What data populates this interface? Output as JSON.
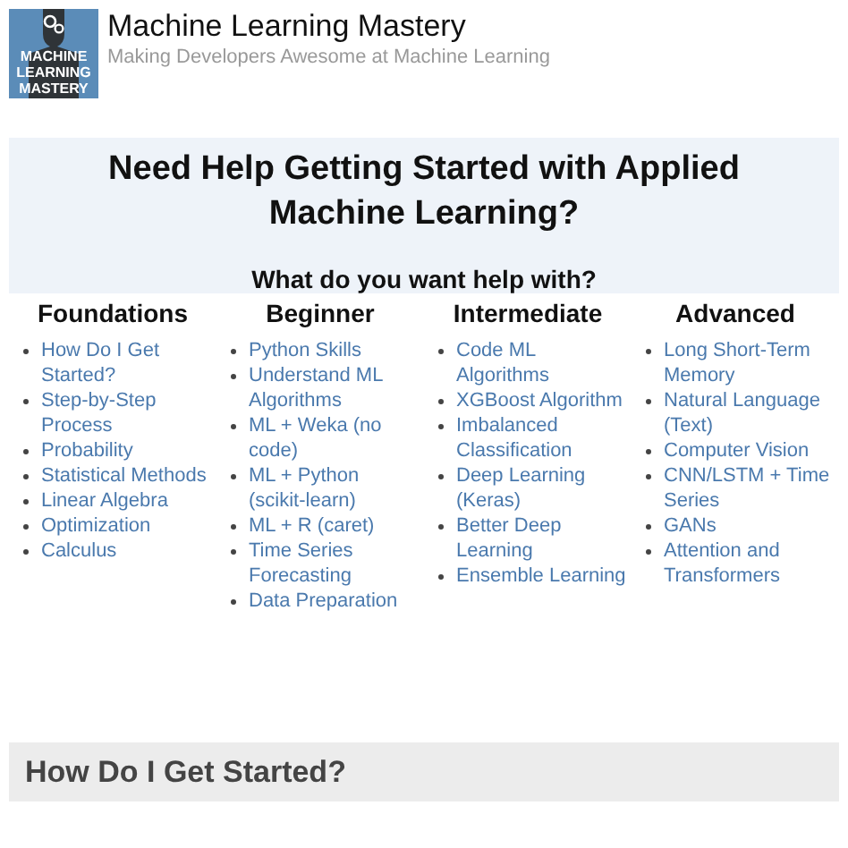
{
  "header": {
    "logo_lines": [
      "MACHINE",
      "LEARNING",
      "MASTERY"
    ],
    "title": "Machine Learning Mastery",
    "tagline": "Making Developers Awesome at Machine Learning"
  },
  "panel": {
    "heading": "Need Help Getting Started with Applied Machine Learning?",
    "subheading": "What do you want help with?"
  },
  "columns": [
    {
      "title": "Foundations",
      "links": [
        "How Do I Get Started?",
        "Step-by-Step Process",
        "Probability",
        "Statistical Methods",
        "Linear Algebra",
        "Optimization",
        "Calculus"
      ]
    },
    {
      "title": "Beginner",
      "links": [
        "Python Skills",
        "Understand ML Algorithms",
        "ML + Weka (no code)",
        "ML + Python (scikit-learn)",
        "ML + R (caret)",
        "Time Series Forecasting",
        "Data Preparation"
      ]
    },
    {
      "title": "Intermediate",
      "links": [
        "Code ML Algorithms",
        "XGBoost Algorithm",
        "Imbalanced Classification",
        "Deep Learning (Keras)",
        "Better Deep Learning",
        "Ensemble Learning"
      ]
    },
    {
      "title": "Advanced",
      "links": [
        "Long Short-Term Memory",
        "Natural Language (Text)",
        "Computer Vision",
        "CNN/LSTM + Time Series",
        "GANs",
        "Attention and Transformers"
      ]
    }
  ],
  "section": {
    "title": "How Do I Get Started?"
  }
}
